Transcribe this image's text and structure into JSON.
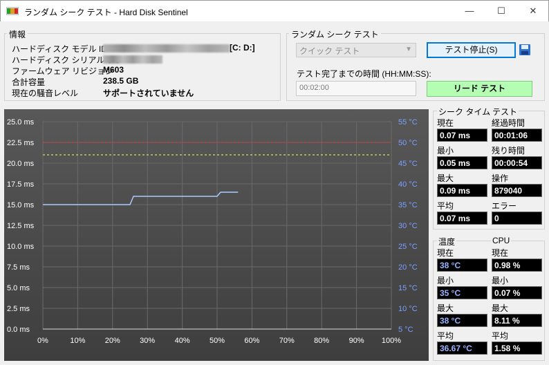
{
  "window": {
    "title": "ランダム シーク テスト - Hard Disk Sentinel",
    "minimize": "—",
    "maximize": "☐",
    "close": "✕"
  },
  "info": {
    "group_title": "情報",
    "model_label": "ハードディスク モデル ID",
    "model_value_suffix": "[C: D:]",
    "serial_label": "ハードディスク シリアル ナン",
    "firmware_label": "ファームウェア リビジョン",
    "firmware_value": "M603",
    "capacity_label": "合計容量",
    "capacity_value": "238.5 GB",
    "noise_label": "現在の騒音レベル",
    "noise_value": "サポートされていません"
  },
  "test": {
    "group_title": "ランダム シーク テスト",
    "type_selected": "クイック テスト",
    "stop_button": "テスト停止(S)",
    "time_label": "テスト完了までの時間 (HH:MM:SS):",
    "time_value": "00:02:00",
    "read_button": "リード テスト"
  },
  "seek_time": {
    "header": "シーク タイム",
    "current_label": "現在",
    "current": "0.07 ms",
    "min_label": "最小",
    "min": "0.05 ms",
    "max_label": "最大",
    "max": "0.09 ms",
    "avg_label": "平均",
    "avg": "0.07 ms"
  },
  "test_stats": {
    "header": "テスト",
    "elapsed_label": "経過時間",
    "elapsed": "00:01:06",
    "remaining_label": "残り時間",
    "remaining": "00:00:54",
    "ops_label": "操作",
    "ops": "879040",
    "errors_label": "エラー",
    "errors": "0"
  },
  "temperature": {
    "header": "温度",
    "current_label": "現在",
    "current": "38 °C",
    "min_label": "最小",
    "min": "35 °C",
    "max_label": "最大",
    "max": "38 °C",
    "avg_label": "平均",
    "avg": "36.67 °C"
  },
  "cpu": {
    "header": "CPU",
    "current_label": "現在",
    "current": "0.98 %",
    "min_label": "最小",
    "min": "0.07 %",
    "max_label": "最大",
    "max": "8.11 %",
    "avg_label": "平均",
    "avg": "1.58 %"
  },
  "colors": {
    "seek_line": "#aaccff",
    "temp_line": "#ffff66",
    "limit_line": "#ff3030",
    "tick_right": "#7aa0ff"
  },
  "chart_data": {
    "type": "line",
    "x_ticks": [
      "0%",
      "10%",
      "20%",
      "30%",
      "40%",
      "50%",
      "60%",
      "70%",
      "80%",
      "90%",
      "100%"
    ],
    "y_left_ticks": [
      "0.0 ms",
      "2.5 ms",
      "5.0 ms",
      "7.5 ms",
      "10.0 ms",
      "12.5 ms",
      "15.0 ms",
      "17.5 ms",
      "20.0 ms",
      "22.5 ms",
      "25.0 ms"
    ],
    "y_right_ticks": [
      "5 °C",
      "10 °C",
      "15 °C",
      "20 °C",
      "25 °C",
      "30 °C",
      "35 °C",
      "40 °C",
      "45 °C",
      "50 °C",
      "55 °C"
    ],
    "xlim": [
      0,
      100
    ],
    "ylim_left": [
      0,
      25
    ],
    "ylim_right": [
      5,
      55
    ],
    "series": [
      {
        "axis": "right",
        "x": [
          0,
          25,
          26,
          50,
          51,
          56
        ],
        "y": [
          35,
          35,
          37,
          37,
          38,
          38
        ]
      }
    ],
    "reference_lines": [
      {
        "axis": "right",
        "value": 50,
        "style": "dashed-red"
      },
      {
        "axis": "right",
        "value": 47,
        "style": "dashed-yellow"
      }
    ],
    "grid": true
  }
}
